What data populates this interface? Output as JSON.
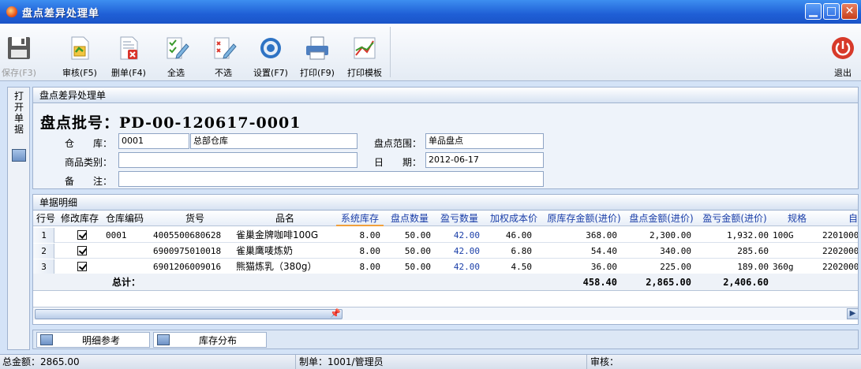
{
  "window": {
    "title": "盘点差异处理单"
  },
  "toolbar": {
    "save": "保存(F3)",
    "audit": "审核(F5)",
    "delete": "删单(F4)",
    "select_all": "全选",
    "deselect": "不选",
    "settings": "设置(F7)",
    "print": "打印(F9)",
    "print_template": "打印模板",
    "exit": "退出"
  },
  "side_tab": {
    "label": "打开单据"
  },
  "header_panel": {
    "title": "盘点差异处理单",
    "doc_no": "盘点批号：PD-00-120617-0001",
    "warehouse_label": "仓　　库：",
    "warehouse_code": "0001",
    "warehouse_name": "总部仓库",
    "scope_label": "盘点范围：",
    "scope_value": "单品盘点",
    "category_label": "商品类别：",
    "category_value": "",
    "date_label": "日　　期：",
    "date_value": "2012-06-17",
    "remark_label": "备　　注：",
    "remark_value": ""
  },
  "grid": {
    "title": "单据明细",
    "columns": [
      "行号",
      "修改库存",
      "仓库编码",
      "货号",
      "品名",
      "系统库存",
      "盘点数量",
      "盈亏数量",
      "加权成本价",
      "原库存金额(进价)",
      "盘点金额(进价)",
      "盈亏金额(进价)",
      "规格",
      "自"
    ],
    "rows": [
      {
        "no": "1",
        "checked": true,
        "wh": "0001",
        "code": "4005500680628",
        "name": "雀巢金牌咖啡100G",
        "sys": "8.00",
        "count": "50.00",
        "diff": "42.00",
        "cost": "46.00",
        "orig_amt": "368.00",
        "count_amt": "2,300.00",
        "diff_amt": "1,932.00",
        "spec": "100G",
        "extra": "2201000"
      },
      {
        "no": "2",
        "checked": true,
        "wh": "",
        "code": "6900975010018",
        "name": "雀巢鹰唛炼奶",
        "sys": "8.00",
        "count": "50.00",
        "diff": "42.00",
        "cost": "6.80",
        "orig_amt": "54.40",
        "count_amt": "340.00",
        "diff_amt": "285.60",
        "spec": "",
        "extra": "2202000"
      },
      {
        "no": "3",
        "checked": true,
        "wh": "",
        "code": "6901206009016",
        "name": "熊猫炼乳（380g）",
        "sys": "8.00",
        "count": "50.00",
        "diff": "42.00",
        "cost": "4.50",
        "orig_amt": "36.00",
        "count_amt": "225.00",
        "diff_amt": "189.00",
        "spec": "360g",
        "extra": "2202000"
      }
    ],
    "total_label": "总计：",
    "total_orig": "458.40",
    "total_count": "2,865.00",
    "total_diff": "2,406.60"
  },
  "bottom_tabs": {
    "tab1": "明细参考",
    "tab2": "库存分布"
  },
  "status": {
    "total": "总金额：2865.00",
    "maker": "制单：1001/管理员",
    "auditor": "审核："
  }
}
